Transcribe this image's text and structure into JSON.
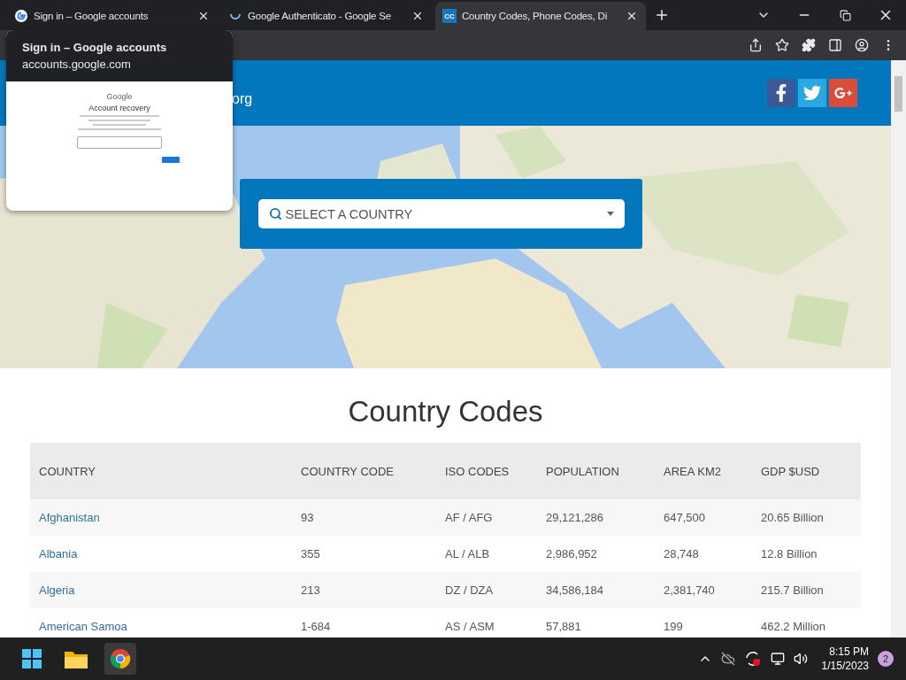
{
  "tabs": [
    {
      "title": "Sign in – Google accounts",
      "kind": "google",
      "selected": false
    },
    {
      "title": "Google Authenticato - Google Se",
      "kind": "loading",
      "selected": false
    },
    {
      "title": "Country Codes, Phone Codes, Di",
      "kind": "cc",
      "favicon_text": "CC",
      "selected": true
    }
  ],
  "tab_preview": {
    "title": "Sign in – Google accounts",
    "url": "accounts.google.com",
    "thumbnail": {
      "logo": "Google",
      "heading": "Account recovery"
    }
  },
  "header": {
    "site_name": "org"
  },
  "search": {
    "placeholder": "SELECT A COUNTRY"
  },
  "title": "Country Codes",
  "table": {
    "columns": [
      "COUNTRY",
      "COUNTRY CODE",
      "ISO CODES",
      "POPULATION",
      "AREA KM2",
      "GDP $USD"
    ],
    "rows": [
      [
        "Afghanistan",
        "93",
        "AF / AFG",
        "29,121,286",
        "647,500",
        "20.65 Billion"
      ],
      [
        "Albania",
        "355",
        "AL / ALB",
        "2,986,952",
        "28,748",
        "12.8 Billion"
      ],
      [
        "Algeria",
        "213",
        "DZ / DZA",
        "34,586,184",
        "2,381,740",
        "215.7 Billion"
      ],
      [
        "American Samoa",
        "1-684",
        "AS / ASM",
        "57,881",
        "199",
        "462.2 Million"
      ]
    ]
  },
  "taskbar": {
    "time": "8:15 PM",
    "date": "1/15/2023",
    "notifications": "2"
  }
}
